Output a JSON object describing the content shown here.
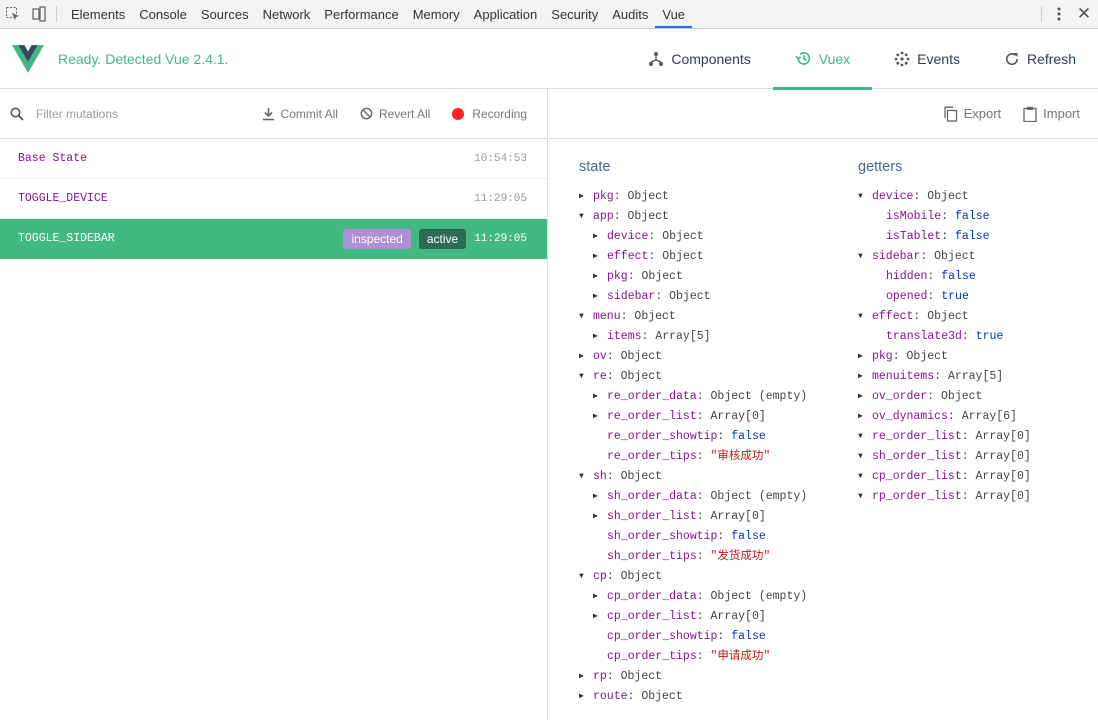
{
  "devtools": {
    "tabs": [
      "Elements",
      "Console",
      "Sources",
      "Network",
      "Performance",
      "Memory",
      "Application",
      "Security",
      "Audits",
      "Vue"
    ],
    "selected_tab": "Vue",
    "close_glyph": "✕",
    "accent": "#1a73e8"
  },
  "header": {
    "ready": "Ready. Detected Vue 2.4.1.",
    "nav": {
      "components": "Components",
      "vuex": "Vuex",
      "events": "Events",
      "refresh": "Refresh"
    },
    "accent": "#42b983"
  },
  "mutations_panel": {
    "filter_placeholder": "Filter mutations",
    "commit_all": "Commit All",
    "revert_all": "Revert All",
    "recording": "Recording",
    "items": [
      {
        "name": "Base State",
        "time": "10:54:53"
      },
      {
        "name": "TOGGLE_DEVICE",
        "time": "11:29:05"
      },
      {
        "name": "TOGGLE_SIDEBAR",
        "time": "11:29:05",
        "tag_inspected": "inspected",
        "tag_active": "active"
      }
    ]
  },
  "inspector": {
    "export": "Export",
    "import": "Import",
    "state_title": "state",
    "getters_title": "getters",
    "state": [
      {
        "key": "pkg",
        "val": "Object",
        "open": false
      },
      {
        "key": "app",
        "val": "Object",
        "open": true
      },
      {
        "key": "device",
        "val": "Object",
        "open": false
      },
      {
        "key": "effect",
        "val": "Object",
        "open": false
      },
      {
        "key": "pkg",
        "val": "Object",
        "open": false
      },
      {
        "key": "sidebar",
        "val": "Object",
        "open": false
      },
      {
        "key": "menu",
        "val": "Object",
        "open": true
      },
      {
        "key": "items",
        "val": "Array[5]",
        "open": false
      },
      {
        "key": "ov",
        "val": "Object",
        "open": false
      },
      {
        "key": "re",
        "val": "Object",
        "open": true
      },
      {
        "key": "re_order_data",
        "val": "Object (empty)",
        "open": false
      },
      {
        "key": "re_order_list",
        "val": "Array[0]",
        "open": false
      },
      {
        "key": "re_order_showtip",
        "val": "false"
      },
      {
        "key": "re_order_tips",
        "val": "\"审核成功\""
      },
      {
        "key": "sh",
        "val": "Object",
        "open": true
      },
      {
        "key": "sh_order_data",
        "val": "Object (empty)",
        "open": false
      },
      {
        "key": "sh_order_list",
        "val": "Array[0]",
        "open": false
      },
      {
        "key": "sh_order_showtip",
        "val": "false"
      },
      {
        "key": "sh_order_tips",
        "val": "\"发货成功\""
      },
      {
        "key": "cp",
        "val": "Object",
        "open": true
      },
      {
        "key": "cp_order_data",
        "val": "Object (empty)",
        "open": false
      },
      {
        "key": "cp_order_list",
        "val": "Array[0]",
        "open": false
      },
      {
        "key": "cp_order_showtip",
        "val": "false"
      },
      {
        "key": "cp_order_tips",
        "val": "\"申请成功\""
      },
      {
        "key": "rp",
        "val": "Object",
        "open": false
      },
      {
        "key": "route",
        "val": "Object",
        "open": false
      }
    ],
    "getters": [
      {
        "key": "device",
        "val": "Object",
        "open": true
      },
      {
        "key": "isMobile",
        "val": "false"
      },
      {
        "key": "isTablet",
        "val": "false"
      },
      {
        "key": "sidebar",
        "val": "Object",
        "open": true
      },
      {
        "key": "hidden",
        "val": "false"
      },
      {
        "key": "opened",
        "val": "true"
      },
      {
        "key": "effect",
        "val": "Object",
        "open": true
      },
      {
        "key": "translate3d",
        "val": "true"
      },
      {
        "key": "pkg",
        "val": "Object",
        "open": false
      },
      {
        "key": "menuitems",
        "val": "Array[5]",
        "open": false
      },
      {
        "key": "ov_order",
        "val": "Object",
        "open": false
      },
      {
        "key": "ov_dynamics",
        "val": "Array[6]",
        "open": false
      },
      {
        "key": "re_order_list",
        "val": "Array[0]",
        "open": true
      },
      {
        "key": "sh_order_list",
        "val": "Array[0]",
        "open": true
      },
      {
        "key": "cp_order_list",
        "val": "Array[0]",
        "open": true
      },
      {
        "key": "rp_order_list",
        "val": "Array[0]",
        "open": true
      }
    ]
  }
}
